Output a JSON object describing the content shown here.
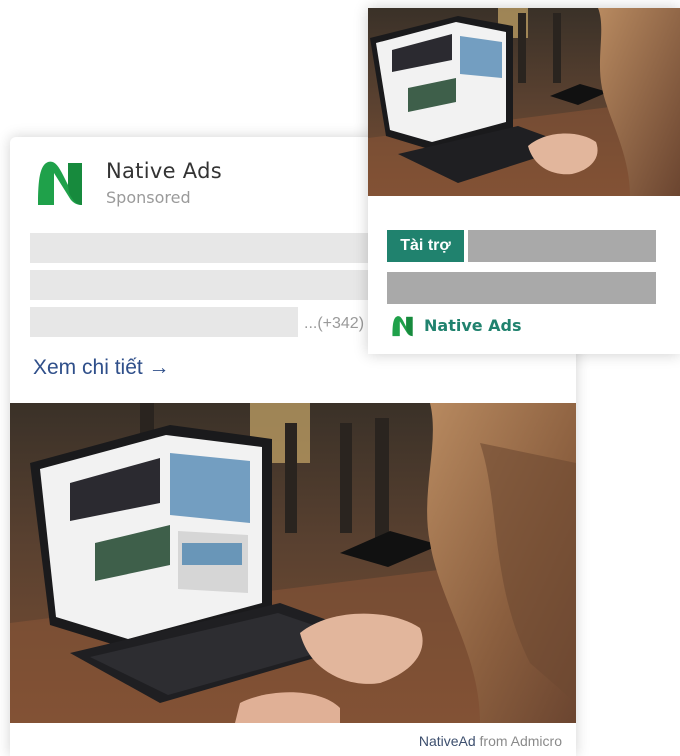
{
  "main_ad": {
    "brand_name": "Native Ads",
    "sponsored_label": "Sponsored",
    "more_count": "...(+342)",
    "detail_link": "Xem chi tiết →",
    "footer_brand": "NativeAd",
    "footer_from": "from Admicro",
    "logo_icon": "native-ads-logo-icon"
  },
  "overlay_ad": {
    "sponsored_badge": "Tài trợ",
    "brand_name": "Native Ads"
  },
  "colors": {
    "brand_green": "#1fa14a",
    "badge_teal": "#20826e",
    "link_blue": "#2f4f8a"
  }
}
